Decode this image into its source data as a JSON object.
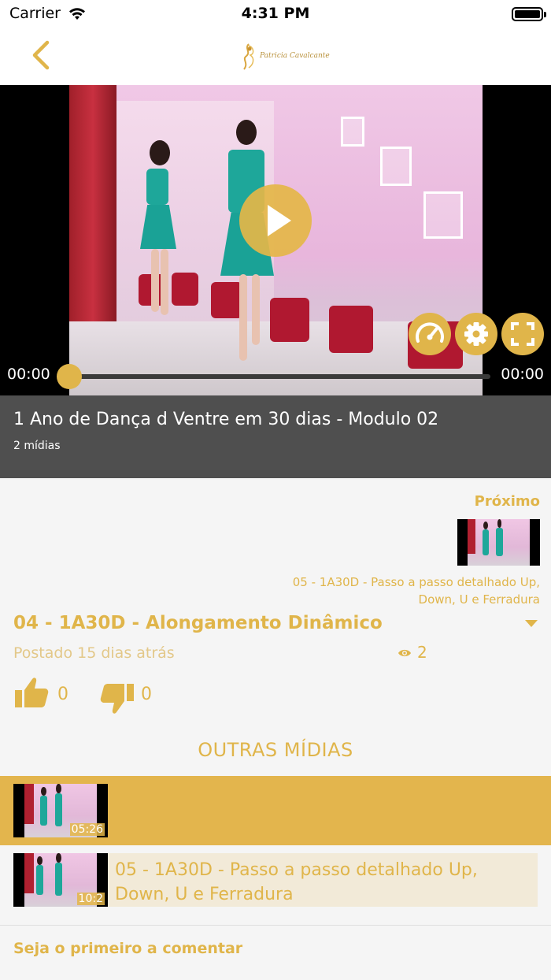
{
  "status_bar": {
    "carrier": "Carrier",
    "time": "4:31 PM"
  },
  "nav": {
    "logo_text": "Patricia Cavalcante"
  },
  "player": {
    "current_time": "00:00",
    "duration": "00:00",
    "progress": 0
  },
  "course": {
    "title": "1 Ano de Dança d Ventre em 30 dias - Modulo 02",
    "media_count": "2 mídias"
  },
  "next": {
    "label": "Próximo",
    "title": "05 - 1A30D - Passo a passo detalhado  Up, Down, U e Ferradura"
  },
  "current_media": {
    "title": "04 - 1A30D -  Alongamento Dinâmico",
    "posted": "Postado 15 dias atrás",
    "views": "2",
    "likes": "0",
    "dislikes": "0"
  },
  "other_media": {
    "header": "OUTRAS MÍDIAS",
    "items": [
      {
        "title": "",
        "duration": "05:26",
        "active": true
      },
      {
        "title": "05 - 1A30D - Passo a passo detalhado  Up, Down, U e Ferradura",
        "duration": "10:2",
        "active": false
      }
    ]
  },
  "comments": {
    "cta": "Seja o primeiro a comentar"
  },
  "colors": {
    "accent": "#e0b54a",
    "band": "#4f4f4f",
    "active_row": "#e3b54d",
    "row_bg": "#f2ead8"
  }
}
